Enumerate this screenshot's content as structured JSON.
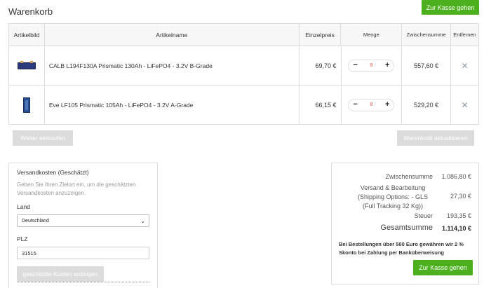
{
  "page": {
    "title": "Warenkorb"
  },
  "actions": {
    "checkout_top": "Zur Kasse gehen",
    "continue_shopping": "Weiter einkaufen",
    "update_cart": "Warenkorb aktualisieren",
    "checkout_bottom": "Zur Kasse gehen"
  },
  "table": {
    "headers": {
      "image": "Artikelbild",
      "name": "Artikelname",
      "unit_price": "Einzelpreis",
      "quantity": "Menge",
      "subtotal": "Zwischensumme",
      "remove": "Entfernen"
    },
    "items": [
      {
        "name": "CALB L194F130A Prismatic 130Ah - LiFePO4 - 3.2V B-Grade",
        "unit_price": "69,70 €",
        "quantity": "8",
        "subtotal": "557,60 €",
        "image_icon": "battery-module-icon"
      },
      {
        "name": "Eve LF105 Prismatic 105Ah - LiFePO4 - 3.2V A-Grade",
        "unit_price": "66,15 €",
        "quantity": "8",
        "subtotal": "529,20 €",
        "image_icon": "battery-cell-icon"
      }
    ],
    "minus": "−",
    "plus": "+",
    "remove_glyph": "✕"
  },
  "shipping": {
    "title": "Versandkosten (Geschätzt)",
    "description": "Geben Sie Ihren Zielort ein, um die geschätzten Versandkosten anzuzeigen.",
    "country_label": "Land",
    "country_value": "Deutschland",
    "zip_label": "PLZ",
    "zip_value": "31515",
    "estimate_button": "geschätzte Kosten anzeigen"
  },
  "totals": {
    "subtotal_label": "Zwischensumme",
    "subtotal_value": "1.086,80 €",
    "shipping_label_1": "Versand & Bearbeitung",
    "shipping_label_2": "(Shipping Options: - GLS",
    "shipping_label_3": "(Full Tracking 32 Kg))",
    "shipping_value": "27,30 €",
    "tax_label": "Steuer",
    "tax_value": "193,35 €",
    "grand_label": "Gesamtsumme",
    "grand_value": "1.114,10 €",
    "note": "Bei Bestellungen über 500 Euro gewähren wir 2 % Skonto bei Zahlung per Banküberweisung"
  },
  "colors": {
    "accent": "#4caf1e",
    "disabled": "#dcdcdc",
    "qty_text": "#d9534f"
  }
}
